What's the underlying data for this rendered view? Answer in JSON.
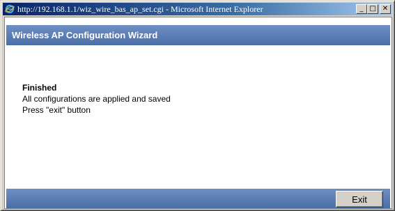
{
  "window": {
    "title": "http://192.168.1.1/wiz_wire_bas_ap_set.cgi - Microsoft Internet Explorer",
    "minimize_glyph": "_",
    "maximize_glyph": "□",
    "close_glyph": "✕"
  },
  "wizard": {
    "header_title": "Wireless AP Configuration Wizard",
    "status_heading": "Finished",
    "message_line_1": "All configurations are applied and saved",
    "message_line_2": "Press \"exit\" button",
    "exit_label": "Exit"
  },
  "icons": {
    "app": "internet-explorer-icon"
  },
  "colors": {
    "titlebar_start": "#0a246a",
    "titlebar_end": "#a6caf0",
    "wizard_bar": "#4a6ea8"
  }
}
